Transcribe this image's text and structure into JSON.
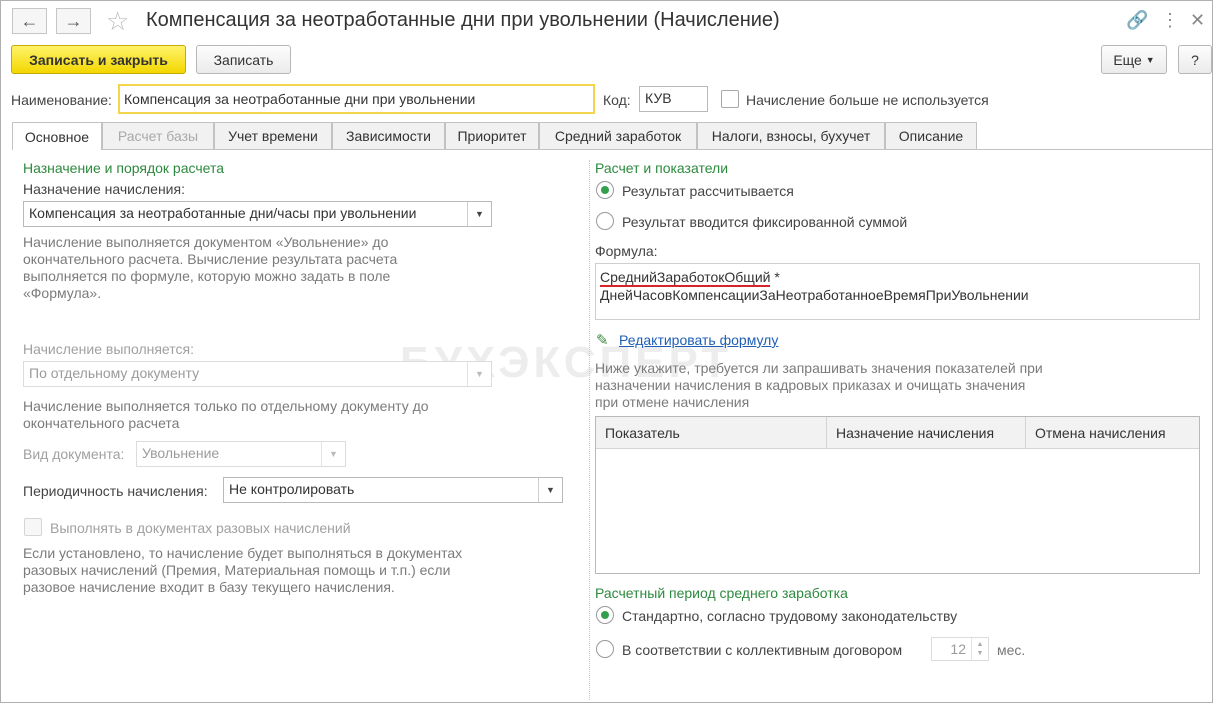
{
  "window": {
    "title": "Компенсация за неотработанные дни при увольнении (Начисление)",
    "back_icon": "arrow-left-icon",
    "forward_icon": "arrow-right-icon"
  },
  "toolbar": {
    "save_close": "Записать и закрыть",
    "save": "Записать",
    "more": "Еще",
    "help": "?"
  },
  "header": {
    "name_label": "Наименование:",
    "name_value": "Компенсация за неотработанные дни при увольнении",
    "code_label": "Код:",
    "code_value": "КУВ",
    "not_used_label": "Начисление больше не используется"
  },
  "tabs": [
    {
      "label": "Основное"
    },
    {
      "label": "Расчет базы"
    },
    {
      "label": "Учет времени"
    },
    {
      "label": "Зависимости"
    },
    {
      "label": "Приоритет"
    },
    {
      "label": "Средний заработок"
    },
    {
      "label": "Налоги, взносы, бухучет"
    },
    {
      "label": "Описание"
    }
  ],
  "left": {
    "section_title": "Назначение и порядок расчета",
    "purpose_label": "Назначение начисления:",
    "purpose_value": "Компенсация за неотработанные дни/часы при увольнении",
    "purpose_note": "Начисление выполняется документом «Увольнение» до окончательного расчета. Вычисление результата расчета выполняется по формуле, которую можно задать в поле «Формула».",
    "performed_label": "Начисление выполняется:",
    "performed_value": "По отдельному документу",
    "performed_note": "Начисление выполняется только по отдельному документу до окончательного расчета",
    "doc_type_label": "Вид документа:",
    "doc_type_value": "Увольнение",
    "periodicity_label": "Периодичность начисления:",
    "periodicity_value": "Не контролировать",
    "oneoff_label": "Выполнять в документах разовых начислений",
    "oneoff_note": "Если установлено, то начисление будет выполняться в документах разовых начислений (Премия, Материальная помощь и т.п.) если разовое начисление входит в базу текущего начисления."
  },
  "right": {
    "section_title": "Расчет и показатели",
    "radio_calculated": "Результат рассчитывается",
    "radio_fixed": "Результат вводится фиксированной суммой",
    "formula_label": "Формула:",
    "formula_part1": "СреднийЗаработокОбщий",
    "formula_part2": " *",
    "formula_line2": "ДнейЧасовКомпенсацииЗаНеотработанноеВремяПриУвольнении",
    "edit_formula": "Редактировать формулу",
    "edit_icon": "pencil-icon",
    "indicators_note": "Ниже укажите, требуется ли запрашивать значения показателей при назначении начисления в кадровых приказах и очищать значения при отмене начисления",
    "table_headers": [
      "Показатель",
      "Назначение начисления",
      "Отмена начисления"
    ],
    "avg_section_title": "Расчетный период среднего заработка",
    "radio_standard": "Стандартно, согласно трудовому законодательству",
    "radio_collective": "В соответствии с коллективным договором",
    "months_value": "12",
    "months_unit": "мес."
  },
  "watermark": "БУХЭКСПЕРТ"
}
